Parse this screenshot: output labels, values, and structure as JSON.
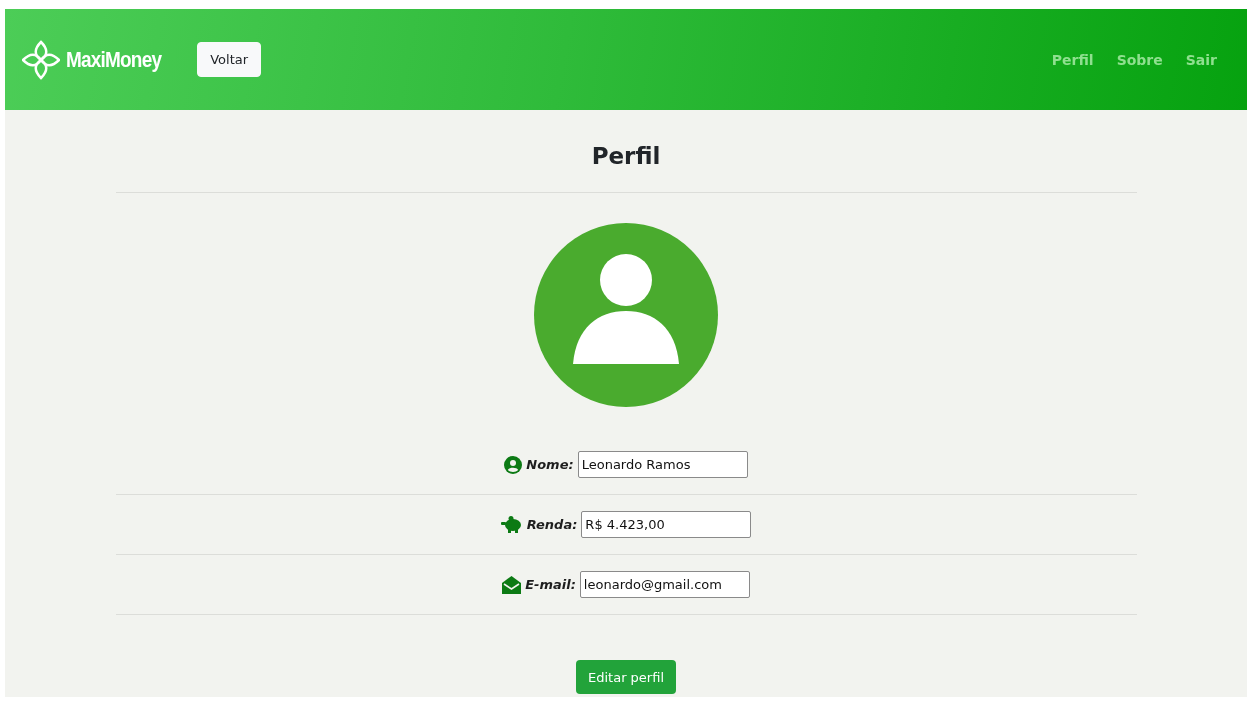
{
  "header": {
    "brand": "MaxiMoney",
    "back_button": "Voltar",
    "nav": [
      {
        "label": "Perfil"
      },
      {
        "label": "Sobre"
      },
      {
        "label": "Sair"
      }
    ]
  },
  "title": "Perfil",
  "fields": [
    {
      "kind": "user",
      "label": "Nome:",
      "value": "Leonardo Ramos"
    },
    {
      "kind": "piggy",
      "label": "Renda:",
      "value": "R$ 4.423,00"
    },
    {
      "kind": "mail",
      "label": "E-mail:",
      "value": "leonardo@gmail.com"
    }
  ],
  "edit_button": "Editar perfil"
}
